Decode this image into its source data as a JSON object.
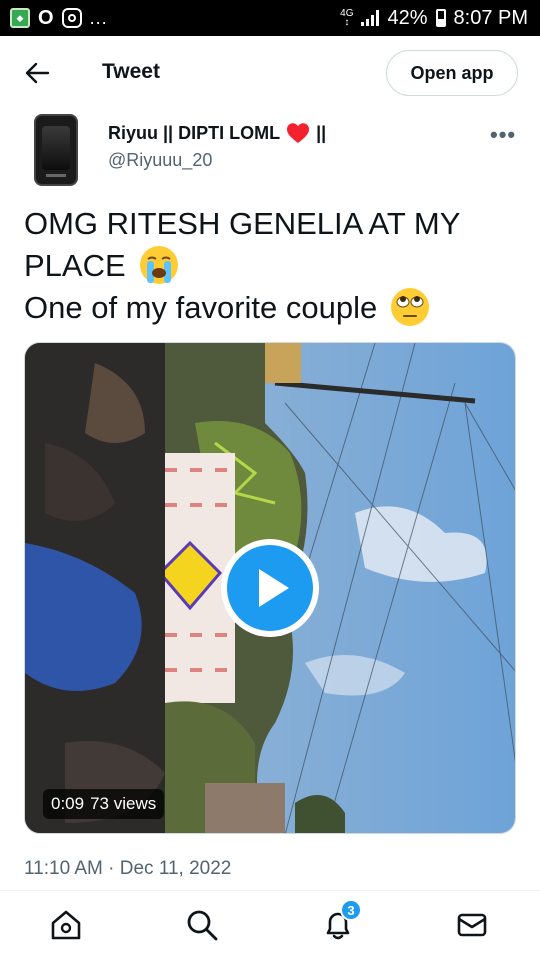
{
  "status_bar": {
    "network": "4G",
    "battery": "42%",
    "time": "8:07 PM",
    "overflow": "..."
  },
  "header": {
    "title": "Tweet",
    "open_app_label": "Open app"
  },
  "author": {
    "name": "Riyuu || DIPTI LOML",
    "name_suffix": "||",
    "handle": "@Riyuuu_20"
  },
  "tweet": {
    "line1": "OMG RITESH GENELIA AT MY",
    "line2": "PLACE",
    "line3": "One of my favorite couple",
    "emoji1": "loudly-crying-face",
    "emoji2": "face-with-rolling-eyes"
  },
  "video": {
    "duration": "0:09",
    "views": "73 views"
  },
  "timestamp": "11:10 AM · Dec 11, 2022",
  "nav": {
    "notifications_badge": "3"
  },
  "colors": {
    "accent": "#1d9bf0",
    "text_primary": "#0f1419",
    "text_secondary": "#536471",
    "heart": "#f4212e"
  }
}
